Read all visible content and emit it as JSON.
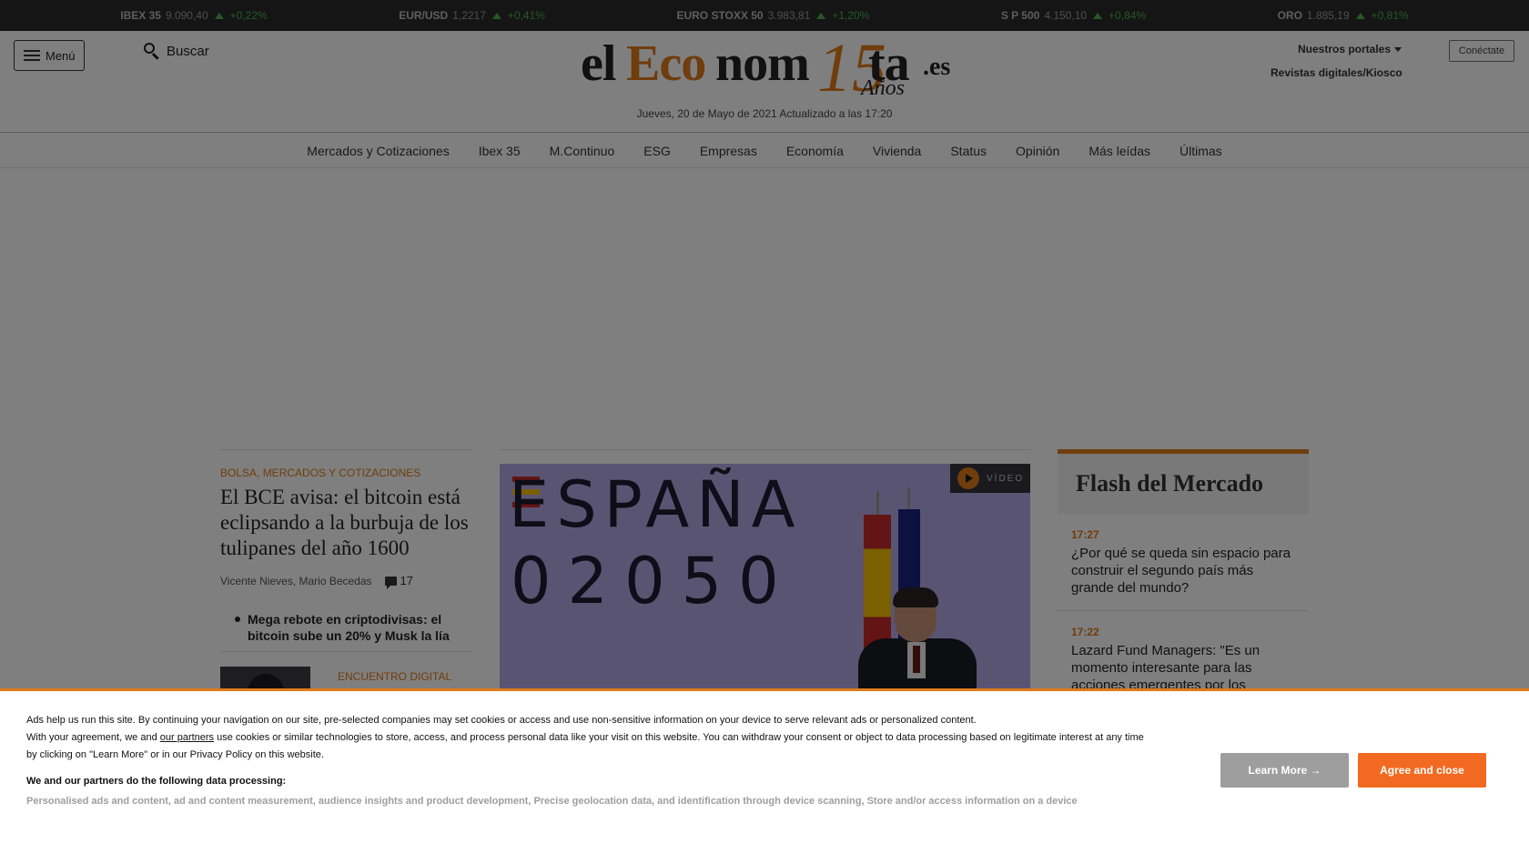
{
  "ticker": [
    {
      "name": "IBEX 35",
      "value": "9.090,40",
      "change": "+0,22%"
    },
    {
      "name": "EUR/USD",
      "value": "1,2217",
      "change": "+0,41%"
    },
    {
      "name": "EURO STOXX 50",
      "value": "3.983,81",
      "change": "+1,20%"
    },
    {
      "name": "S P 500",
      "value": "4.150,10",
      "change": "+0,84%"
    },
    {
      "name": "ORO",
      "value": "1.885,19",
      "change": "+0,81%"
    }
  ],
  "header": {
    "menu_label": "Menú",
    "search_label": "Buscar",
    "logo": {
      "el": "el",
      "eco": "Eco",
      "nom": "nom",
      "num": "15",
      "ta": "ta",
      "es": ".es",
      "anos": "Años"
    },
    "date": "Jueves, 20 de Mayo de 2021 Actualizado a las 17:20",
    "portales_label": "Nuestros portales",
    "revistas_label": "Revistas digitales/Kiosco",
    "connect_label": "Conéctate"
  },
  "nav": [
    "Mercados y Cotizaciones",
    "Ibex 35",
    "M.Continuo",
    "ESG",
    "Empresas",
    "Economía",
    "Vivienda",
    "Status",
    "Opinión",
    "Más leídas",
    "Últimas"
  ],
  "lead": {
    "kicker": "Bolsa, mercados y cotizaciones",
    "headline": "El BCE avisa: el bitcoin está eclipsando a la burbuja de los tulipanes del año 1600",
    "authors": "Vicente Nieves, Mario Becedas",
    "comments": "17",
    "related": "Mega rebote en criptodivisas: el bitcoin sube un 20% y Musk la lía",
    "second_kicker": "Encuentro Digital"
  },
  "video": {
    "badge_label": "VÍDEO",
    "word_top": "ESPAÑA",
    "word_bottom": "02050"
  },
  "flash": {
    "title": "Flash del Mercado",
    "items": [
      {
        "time": "17:27",
        "text": "¿Por qué se queda sin espacio para construir el segundo país más grande del mundo?"
      },
      {
        "time": "17:22",
        "text": "Lazard Fund Managers: \"Es un momento interesante para las acciones emergentes por los"
      }
    ]
  },
  "consent": {
    "text1": "Ads help us run this site. By continuing your navigation on our site, pre-selected companies may set cookies or access and use non-sensitive information on your device to serve relevant ads or personalized content.",
    "text2_pre": "With your agreement, we and ",
    "partners_link": "our partners",
    "text2_post": " use cookies or similar technologies to store, access, and process personal data like your visit on this website. You can withdraw your consent or object to data processing based on legitimate interest at any time by clicking on \"Learn More\" or in our Privacy Policy on this website.",
    "heading": "We and our partners do the following data processing:",
    "purposes": "Personalised ads and content, ad and content measurement, audience insights and product development, Precise geolocation data, and identification through device scanning, Store and/or access information on a device",
    "learn_more": "Learn More →",
    "agree": "Agree and close"
  },
  "colors": {
    "accent": "#e07a1a",
    "agree": "#f26a21",
    "up": "#4caf50"
  }
}
